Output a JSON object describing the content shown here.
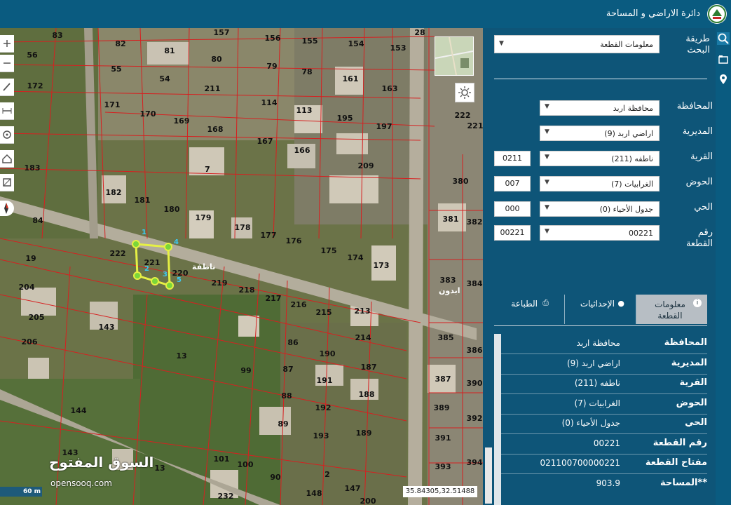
{
  "header": {
    "title": "دائرة الاراضي و المساحة",
    "logo_icon": "jordan-dls-logo-icon",
    "bar_color": "#0a5b80"
  },
  "right_strip": {
    "icons": [
      "search-icon",
      "folder-icon",
      "location-pin-icon"
    ]
  },
  "map": {
    "tools": [
      "zoom-in-icon",
      "zoom-out-icon",
      "pencil-icon",
      "measure-icon",
      "target-icon",
      "home-icon",
      "layers-icon"
    ],
    "compass_icon": "compass-icon",
    "sun_button_icon": "brightness-icon",
    "scale_text": "60 m",
    "coordinates": "35.84305,32.51488",
    "watermark": {
      "arabic": "السوق المفتوح",
      "english": "opensooq.com"
    },
    "street_label": "ناطفة",
    "annotation": "ابدون",
    "vertex_numbers": [
      "1",
      "2",
      "3",
      "4",
      "5"
    ],
    "highlight_color": "#e6f044",
    "parcel_line_color": "#d62020",
    "parcels": [
      "83",
      "82",
      "81",
      "157",
      "156",
      "155",
      "154",
      "153",
      "28",
      "56",
      "55",
      "54",
      "80",
      "79",
      "78",
      "161",
      "163",
      "172",
      "211",
      "171",
      "170",
      "169",
      "168",
      "114",
      "113",
      "195",
      "197",
      "222",
      "221",
      "167",
      "166",
      "209",
      "183",
      "7",
      "182",
      "181",
      "380",
      "180",
      "179",
      "178",
      "177",
      "176",
      "175",
      "174",
      "173",
      "381",
      "382",
      "84",
      "222",
      "221",
      "220",
      "219",
      "218",
      "217",
      "216",
      "215",
      "213",
      "19",
      "204",
      "205",
      "206",
      "143",
      "383",
      "384",
      "385",
      "386",
      "214",
      "187",
      "190",
      "86",
      "13",
      "87",
      "191",
      "99",
      "387",
      "390",
      "144",
      "188",
      "88",
      "192",
      "389",
      "392",
      "89",
      "193",
      "189",
      "391",
      "143",
      "101",
      "100",
      "90",
      "393",
      "394",
      "13",
      "232",
      "148",
      "147",
      "200",
      "2"
    ]
  },
  "search_panel": {
    "search_method_label": "طريقة البحث",
    "search_method_value": "معلومات القطعة",
    "fields": [
      {
        "label": "المحافظة",
        "value": "محافظة اربد",
        "code": ""
      },
      {
        "label": "المديرية",
        "value": "اراضي اربد (9)",
        "code": ""
      },
      {
        "label": "القرية",
        "value": "ناطفه (211)",
        "code": "0211"
      },
      {
        "label": "الحوض",
        "value": "الغرابيات (7)",
        "code": "007"
      },
      {
        "label": "الحي",
        "value": "جدول الأحياء (0)",
        "code": "000"
      },
      {
        "label": "رقم القطعة",
        "value": "00221",
        "code": "00221"
      }
    ]
  },
  "tabs": [
    {
      "label": "معلومات القطعة",
      "icon": "info-icon",
      "active": true
    },
    {
      "label": "الإحداثيات",
      "icon": "user-pin-icon",
      "active": false
    },
    {
      "label": "الطباعة",
      "icon": "printer-icon",
      "active": false
    }
  ],
  "parcel_info": [
    {
      "key": "المحافظة",
      "value": "محافظة اربد"
    },
    {
      "key": "المديرية",
      "value": "اراضي اربد (9)"
    },
    {
      "key": "القرية",
      "value": "ناطفه (211)"
    },
    {
      "key": "الحوض",
      "value": "الغرابيات (7)"
    },
    {
      "key": "الحي",
      "value": "جدول الأحياء (0)"
    },
    {
      "key": "رقم القطعة",
      "value": "00221"
    },
    {
      "key": "مفتاح القطعة",
      "value": "021100700000221"
    },
    {
      "key": "**المساحة",
      "value": "903.9"
    }
  ]
}
